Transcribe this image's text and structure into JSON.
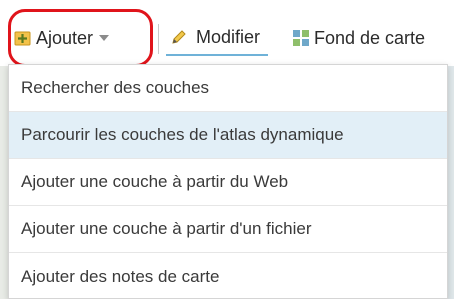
{
  "toolbar": {
    "add_label": "Ajouter",
    "modify_label": "Modifier",
    "basemap_label": "Fond de carte"
  },
  "menu": {
    "items": [
      {
        "label": "Rechercher des couches"
      },
      {
        "label": "Parcourir les couches de l'atlas dynamique"
      },
      {
        "label": "Ajouter une couche à partir du Web"
      },
      {
        "label": "Ajouter une couche à partir d'un fichier"
      },
      {
        "label": "Ajouter des notes de carte"
      }
    ]
  },
  "icons": {
    "add": "add-layer-icon",
    "modify": "pencil-icon",
    "basemap": "basemap-grid-icon",
    "caret": "chevron-down-icon"
  },
  "colors": {
    "highlight_ring": "#e0141b",
    "hover_bg": "#e2eff7",
    "active_underline": "#6fb2d8"
  }
}
